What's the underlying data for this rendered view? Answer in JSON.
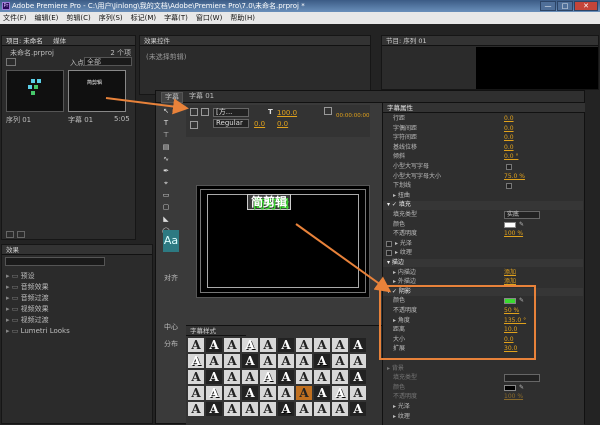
{
  "app": {
    "logo": "Pr",
    "title": "Adobe Premiere Pro - C:\\用户\\Jinlong\\我的文档\\Adobe\\Premiere Pro\\7.0\\未命名.prproj *",
    "buttons": [
      "—",
      "□",
      "✕"
    ]
  },
  "menu": [
    "文件(F)",
    "编辑(E)",
    "剪辑(C)",
    "序列(S)",
    "标记(M)",
    "字幕(T)",
    "窗口(W)",
    "帮助(H)"
  ],
  "project": {
    "tab": "项目: 未命名",
    "tab_extra": "媒体",
    "filename": "未命名.prproj",
    "count": "2 个项",
    "in_label": "入点:",
    "in_value": "全部",
    "items": [
      {
        "name": "序列 01",
        "duration": ""
      },
      {
        "name": "字幕 01",
        "duration": "5:05",
        "thumb_text": "简剪辑"
      }
    ]
  },
  "effects_controls": {
    "tab": "效果控件",
    "empty": "(未选择剪辑)"
  },
  "program": {
    "tab": "节目: 序列 01"
  },
  "effects": {
    "tab": "效果",
    "folders": [
      "预设",
      "音频效果",
      "音频过渡",
      "视频效果",
      "视频过渡",
      "Lumetri Looks"
    ]
  },
  "titler": {
    "tabs": [
      "字幕",
      "字幕 01"
    ],
    "props_tab": "字幕属性",
    "styles_tab": "字幕样式",
    "font_family": "[方...",
    "font_style": "Regular",
    "font_size": "100.0",
    "kerning": "0.0",
    "leading": "0.0",
    "timecode": "00:00:00:00",
    "canvas_text": "简剪辑",
    "left_labels": {
      "align": "对齐",
      "center": "中心",
      "dist": "分布"
    },
    "style_glyph": "Aa"
  },
  "properties": [
    {
      "key": "行距",
      "value": "0.0",
      "type": "v",
      "indent": 2
    },
    {
      "key": "字偶间距",
      "value": "0.0",
      "type": "v",
      "indent": 2
    },
    {
      "key": "字符间距",
      "value": "0.0",
      "type": "v",
      "indent": 2
    },
    {
      "key": "基线位移",
      "value": "0.0",
      "type": "v",
      "indent": 2
    },
    {
      "key": "倾斜",
      "value": "0.0 °",
      "type": "v",
      "indent": 2
    },
    {
      "key": "小型大写字母",
      "value": "",
      "type": "cb",
      "indent": 2
    },
    {
      "key": "小型大写字母大小",
      "value": "75.0 %",
      "type": "v",
      "indent": 2
    },
    {
      "key": "下划线",
      "value": "",
      "type": "cb",
      "indent": 2
    },
    {
      "key": "▸ 扭曲",
      "value": "",
      "type": "none",
      "indent": 2
    },
    {
      "key": "▾ ✓ 填充",
      "value": "",
      "type": "hdr",
      "indent": 0
    },
    {
      "key": "填充类型",
      "value": "实底",
      "type": "select",
      "indent": 2
    },
    {
      "key": "颜色",
      "value": "",
      "type": "swatch-white",
      "indent": 2
    },
    {
      "key": "不透明度",
      "value": "100 %",
      "type": "v",
      "indent": 2
    },
    {
      "key": "▸ 光泽",
      "value": "",
      "type": "cb-pre",
      "indent": 2
    },
    {
      "key": "▸ 纹理",
      "value": "",
      "type": "cb-pre",
      "indent": 2
    },
    {
      "key": "▾ 描边",
      "value": "",
      "type": "hdr",
      "indent": 0
    },
    {
      "key": "▸ 内描边",
      "value": "添加",
      "type": "v",
      "indent": 2
    },
    {
      "key": "▸ 外描边",
      "value": "添加",
      "type": "v",
      "indent": 2
    },
    {
      "key": "▾ ✓ 阴影",
      "value": "",
      "type": "hdr",
      "indent": 0
    },
    {
      "key": "颜色",
      "value": "",
      "type": "swatch-green",
      "indent": 2
    },
    {
      "key": "不透明度",
      "value": "50 %",
      "type": "v",
      "indent": 2
    },
    {
      "key": "▸ 角度",
      "value": "135.0 °",
      "type": "v",
      "indent": 2
    },
    {
      "key": "距离",
      "value": "10.0",
      "type": "v",
      "indent": 2
    },
    {
      "key": "大小",
      "value": "0.0",
      "type": "v",
      "indent": 2
    },
    {
      "key": "扩展",
      "value": "30.0",
      "type": "v",
      "indent": 2
    },
    {
      "key": "",
      "value": "",
      "type": "none",
      "indent": 0
    },
    {
      "key": "▸ 背景",
      "value": "",
      "type": "hdr-dim",
      "indent": 0
    },
    {
      "key": "填充类型",
      "value": "",
      "type": "select-dim",
      "indent": 2
    },
    {
      "key": "颜色",
      "value": "",
      "type": "swatch-black",
      "indent": 2
    },
    {
      "key": "不透明度",
      "value": "100 %",
      "type": "v-dim",
      "indent": 2
    },
    {
      "key": "▸ 光泽",
      "value": "",
      "type": "none",
      "indent": 2
    },
    {
      "key": "▸ 纹理",
      "value": "",
      "type": "none",
      "indent": 2
    }
  ],
  "colors": {
    "highlight": "#e8823a",
    "value_orange": "#e1a21c",
    "shadow_green": "#3adb2f"
  }
}
